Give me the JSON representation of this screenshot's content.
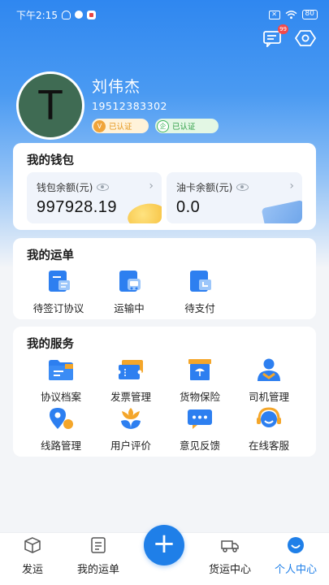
{
  "status_bar": {
    "time": "下午2:15",
    "battery": "80"
  },
  "header": {
    "message_badge": "99"
  },
  "profile": {
    "avatar_letter": "T",
    "name": "刘伟杰",
    "phone": "19512383302",
    "cert_badges": [
      {
        "icon_text": "V",
        "label": "已认证"
      },
      {
        "icon_text": "企",
        "label": "已认证"
      }
    ]
  },
  "wallet": {
    "title": "我的钱包",
    "balance_label": "钱包余额(元)",
    "balance_value": "997928.19",
    "fuel_label": "油卡余额(元)",
    "fuel_value": "0.0"
  },
  "orders": {
    "title": "我的运单",
    "items": [
      {
        "label": "待签订协议",
        "icon": "contract-doc-icon"
      },
      {
        "label": "运输中",
        "icon": "truck-transit-icon"
      },
      {
        "label": "待支付",
        "icon": "payment-pending-icon"
      }
    ]
  },
  "services": {
    "title": "我的服务",
    "items": [
      {
        "label": "协议档案",
        "icon": "folder-icon"
      },
      {
        "label": "发票管理",
        "icon": "invoice-icon"
      },
      {
        "label": "货物保险",
        "icon": "insurance-umbrella-icon"
      },
      {
        "label": "司机管理",
        "icon": "driver-icon"
      },
      {
        "label": "线路管理",
        "icon": "route-pin-icon"
      },
      {
        "label": "用户评价",
        "icon": "flower-review-icon"
      },
      {
        "label": "意见反馈",
        "icon": "feedback-chat-icon"
      },
      {
        "label": "在线客服",
        "icon": "headset-icon"
      }
    ]
  },
  "bottom_nav": {
    "items": [
      {
        "label": "发运",
        "icon": "box-icon"
      },
      {
        "label": "我的运单",
        "icon": "list-doc-icon"
      },
      {
        "label": "货运中心",
        "icon": "truck-icon"
      },
      {
        "label": "个人中心",
        "icon": "smile-user-icon",
        "active": true
      }
    ],
    "fab_label": "+"
  },
  "colors": {
    "primary": "#1f7fe8",
    "hero_top": "#2f87f0",
    "icon_orange": "#f4a62a",
    "icon_blue": "#2d7ff0"
  }
}
